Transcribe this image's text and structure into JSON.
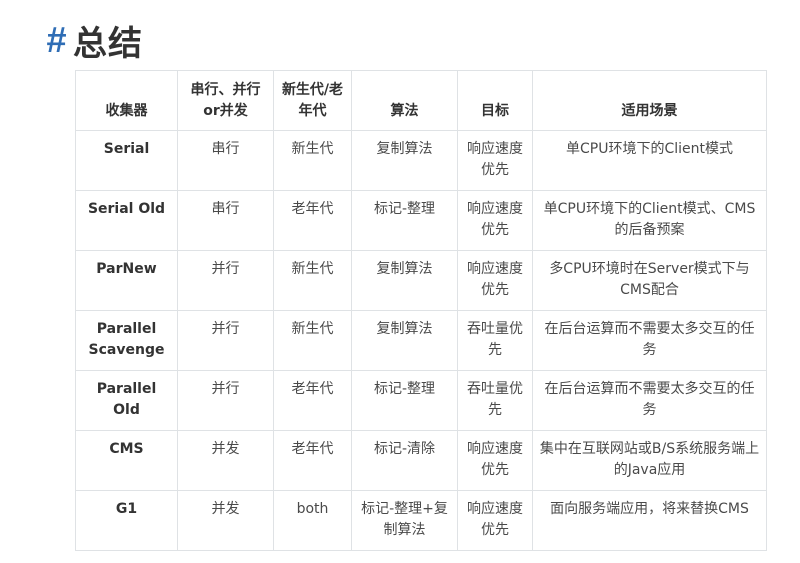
{
  "heading": {
    "hash": "#",
    "title": "总结"
  },
  "table": {
    "headers": [
      "收集器",
      "串行、并行or并发",
      "新生代/老年代",
      "算法",
      "目标",
      "适用场景"
    ],
    "rows": [
      {
        "collector": "Serial",
        "mode": "串行",
        "generation": "新生代",
        "algorithm": "复制算法",
        "goal": "响应速度优先",
        "scenario": "单CPU环境下的Client模式"
      },
      {
        "collector": "Serial Old",
        "mode": "串行",
        "generation": "老年代",
        "algorithm": "标记-整理",
        "goal": "响应速度优先",
        "scenario": "单CPU环境下的Client模式、CMS的后备预案"
      },
      {
        "collector": "ParNew",
        "mode": "并行",
        "generation": "新生代",
        "algorithm": "复制算法",
        "goal": "响应速度优先",
        "scenario": "多CPU环境时在Server模式下与CMS配合"
      },
      {
        "collector": "Parallel Scavenge",
        "mode": "并行",
        "generation": "新生代",
        "algorithm": "复制算法",
        "goal": "吞吐量优先",
        "scenario": "在后台运算而不需要太多交互的任务"
      },
      {
        "collector": "Parallel Old",
        "mode": "并行",
        "generation": "老年代",
        "algorithm": "标记-整理",
        "goal": "吞吐量优先",
        "scenario": "在后台运算而不需要太多交互的任务"
      },
      {
        "collector": "CMS",
        "mode": "并发",
        "generation": "老年代",
        "algorithm": "标记-清除",
        "goal": "响应速度优先",
        "scenario": "集中在互联网站或B/S系统服务端上的Java应用"
      },
      {
        "collector": "G1",
        "mode": "并发",
        "generation": "both",
        "algorithm": "标记-整理+复制算法",
        "goal": "响应速度优先",
        "scenario": "面向服务端应用，将来替换CMS"
      }
    ]
  }
}
